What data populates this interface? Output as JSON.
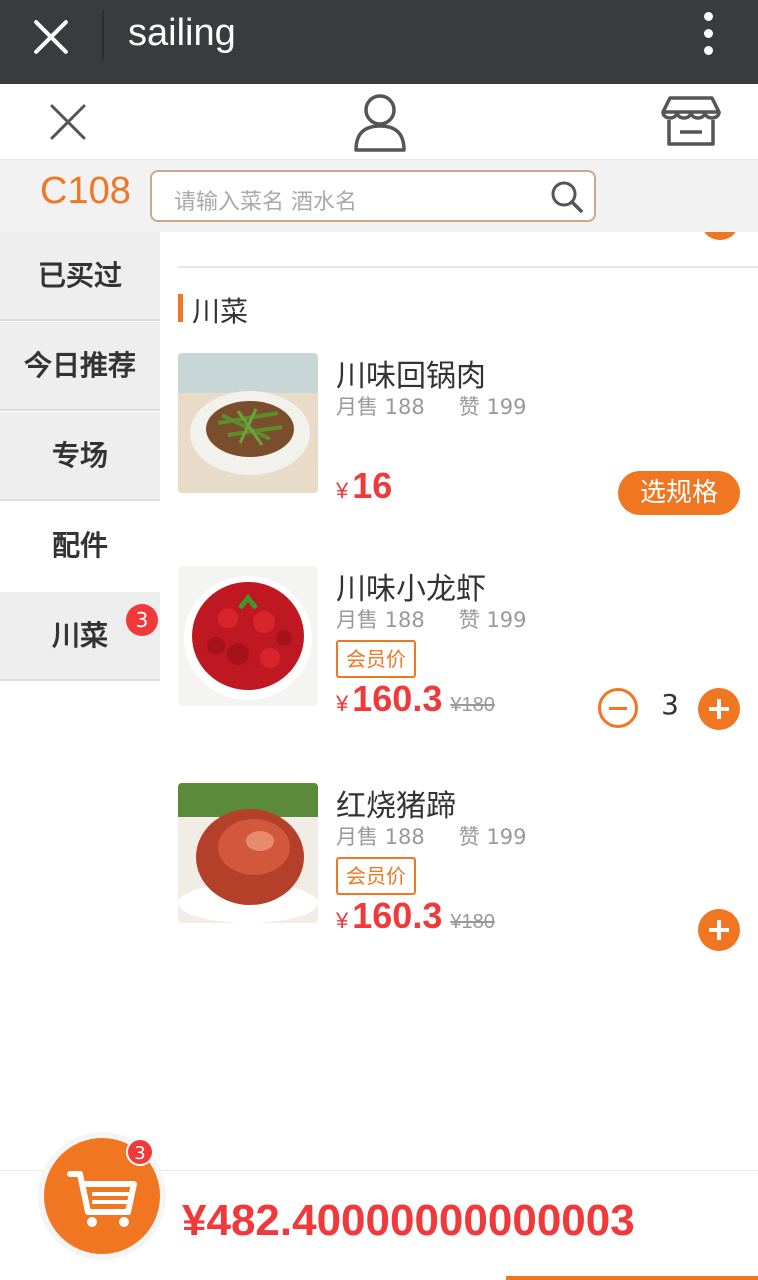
{
  "titlebar": {
    "title": "sailing",
    "close_icon": "close-icon",
    "more_icon": "more-vertical-icon"
  },
  "toolbar": {
    "left_icon": "close-icon",
    "center_icon": "user-icon",
    "right_icon": "store-icon"
  },
  "table_no": "C108",
  "search": {
    "placeholder": "请输入菜名 酒水名",
    "icon": "search-icon"
  },
  "sidebar": {
    "items": [
      {
        "label": "已买过"
      },
      {
        "label": "今日推荐"
      },
      {
        "label": "专场"
      },
      {
        "label": "配件",
        "active": true
      },
      {
        "label": "川菜",
        "badge": "3"
      }
    ]
  },
  "category": {
    "title": "川菜"
  },
  "dishes": [
    {
      "name": "川味回锅肉",
      "monthly_sales": "月售 188",
      "likes": "赞 199",
      "currency": "¥",
      "price": "16",
      "action": "选规格"
    },
    {
      "name": "川味小龙虾",
      "monthly_sales": "月售 188",
      "likes": "赞 199",
      "member_tag": "会员价",
      "currency": "¥",
      "price": "160.3",
      "original_price": "¥180",
      "quantity": "3"
    },
    {
      "name": "红烧猪蹄",
      "monthly_sales": "月售 188",
      "likes": "赞 199",
      "member_tag": "会员价",
      "currency": "¥",
      "price": "160.3",
      "original_price": "¥180"
    }
  ],
  "cart": {
    "badge": "3",
    "total": "¥482.40000000000003",
    "icon": "cart-icon"
  },
  "colors": {
    "accent": "#f07621",
    "price": "#f0393b",
    "titlebar": "#393b3f"
  }
}
